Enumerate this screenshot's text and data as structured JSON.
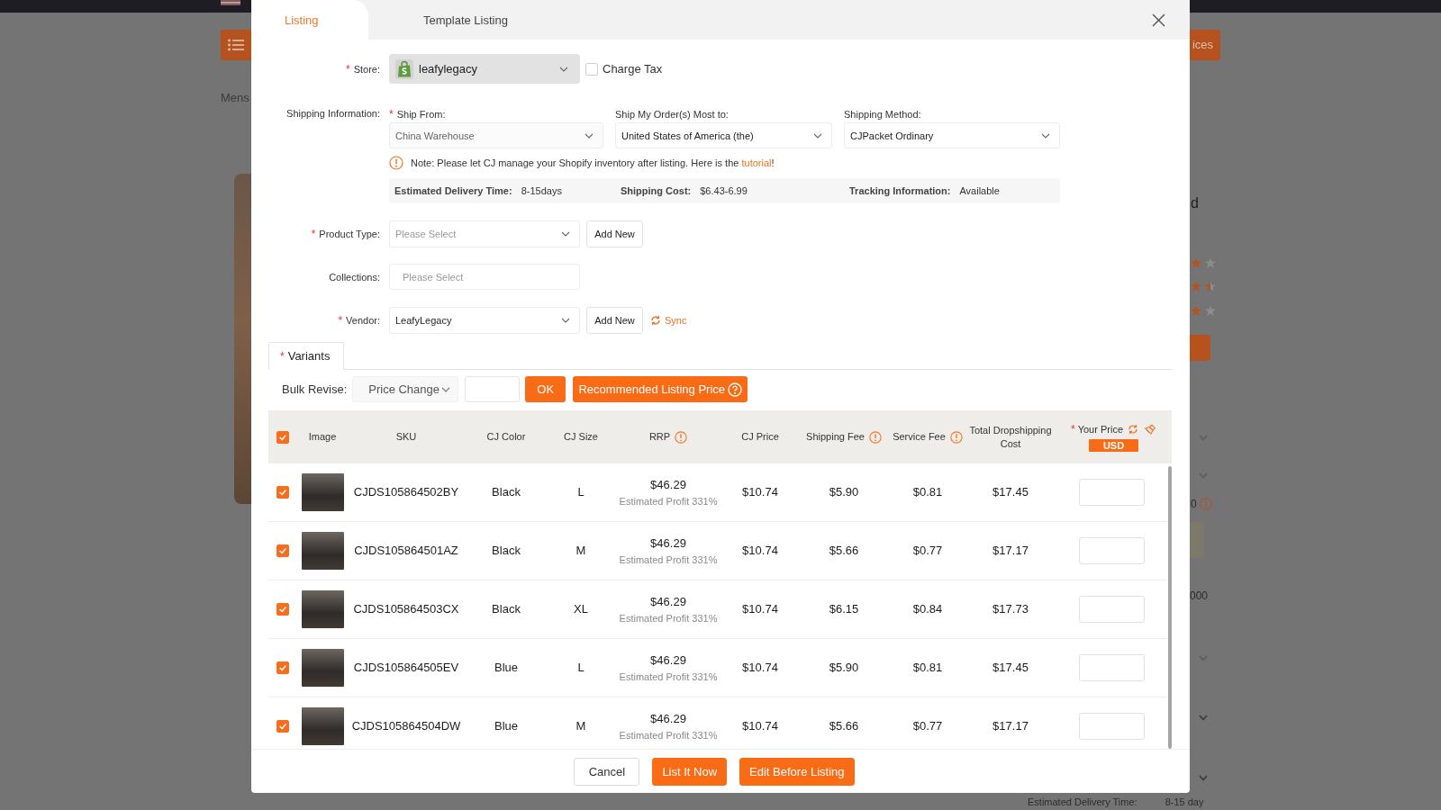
{
  "background_page": {
    "breadcrumb": "Mens",
    "header_button": "ices",
    "title_fragment": "d",
    "rating_rows": [
      {
        "icons": [
          {
            "kind": "full"
          },
          {
            "kind": "empty"
          }
        ]
      },
      {
        "icons": [
          {
            "kind": "full"
          },
          {
            "kind": "half"
          }
        ]
      },
      {
        "icons": [
          {
            "kind": "full"
          },
          {
            "kind": "empty"
          }
        ]
      }
    ],
    "count_fragment": "0",
    "amount_fragment": "000",
    "delivery_label": "Estimated Delivery Time:",
    "delivery_value": "8-15 day"
  },
  "dialog": {
    "tabs": [
      {
        "label": "Listing",
        "selected": true
      },
      {
        "label": "Template Listing",
        "selected": false
      }
    ]
  },
  "required_mark": "*",
  "form": {
    "store": {
      "label": "Store:",
      "required": true,
      "value": "leafylegacy",
      "disabled": true
    },
    "charge_tax": {
      "label": "Charge Tax",
      "checked": false
    },
    "shipping": {
      "label": "Shipping Information:",
      "fields": [
        {
          "label": "Ship From:",
          "required": true,
          "value": "China Warehouse",
          "disabled": true
        },
        {
          "label": "Ship My Order(s) Most to:",
          "required": false,
          "value": "United States of America (the)",
          "disabled": false
        },
        {
          "label": "Shipping Method:",
          "required": false,
          "value": "CJPacket Ordinary",
          "disabled": false
        }
      ],
      "note": {
        "text": "Note: Please let CJ manage your Shopify inventory after listing. Here is the ",
        "link": "tutorial",
        "end": "!"
      },
      "summary": [
        {
          "label": "Estimated Delivery Time:",
          "value": "8-15days"
        },
        {
          "label": "Shipping Cost:",
          "value": "$6.43-6.99"
        },
        {
          "label": "Tracking Information:",
          "value": "Available"
        }
      ]
    },
    "product_type": {
      "label": "Product Type:",
      "required": true,
      "placeholder": "Please Select",
      "button": "Add New"
    },
    "collections": {
      "label": "Collections:",
      "required": false,
      "placeholder": "Please Select"
    },
    "vendor": {
      "label": "Vendor:",
      "required": true,
      "value": "LeafyLegacy",
      "button": "Add New",
      "sync": "Sync"
    }
  },
  "variants": {
    "tab": {
      "label": "Variants",
      "required": true
    },
    "bulk_revise": {
      "label": "Bulk Revise:",
      "mode": "Price Change",
      "ok": "OK",
      "recommend": "Recommended Listing Price"
    },
    "table": {
      "select_all": {
        "checked": true
      },
      "columns": [
        {
          "label": "Image",
          "required": false,
          "info": false,
          "actions": false
        },
        {
          "label": "SKU",
          "required": false,
          "info": false,
          "actions": false
        },
        {
          "label": "CJ Color",
          "required": false,
          "info": false,
          "actions": false
        },
        {
          "label": "CJ Size",
          "required": false,
          "info": false,
          "actions": false
        },
        {
          "label": "RRP",
          "required": false,
          "info": true,
          "actions": false
        },
        {
          "label": "CJ Price",
          "required": false,
          "info": false,
          "actions": false
        },
        {
          "label": "Shipping Fee",
          "required": false,
          "info": true,
          "actions": false
        },
        {
          "label": "Service Fee",
          "required": false,
          "info": true,
          "actions": false
        },
        {
          "label": "Total Dropshipping Cost",
          "required": false,
          "info": false,
          "actions": false
        },
        {
          "label": "Your Price",
          "required": true,
          "info": false,
          "actions": true,
          "currency": "USD"
        }
      ],
      "rows": [
        {
          "checked": true,
          "sku": "CJDS105864502BY",
          "cj_color": "Black",
          "size": "L",
          "rrp": "$46.29",
          "profit": "Estimated Profit 331%",
          "cj_price": "$10.74",
          "shipping_fee": "$5.90",
          "service_fee": "$0.81",
          "total": "$17.45"
        },
        {
          "checked": true,
          "sku": "CJDS105864501AZ",
          "cj_color": "Black",
          "size": "M",
          "rrp": "$46.29",
          "profit": "Estimated Profit 331%",
          "cj_price": "$10.74",
          "shipping_fee": "$5.66",
          "service_fee": "$0.77",
          "total": "$17.17"
        },
        {
          "checked": true,
          "sku": "CJDS105864503CX",
          "cj_color": "Black",
          "size": "XL",
          "rrp": "$46.29",
          "profit": "Estimated Profit 331%",
          "cj_price": "$10.74",
          "shipping_fee": "$6.15",
          "service_fee": "$0.84",
          "total": "$17.73"
        },
        {
          "checked": true,
          "sku": "CJDS105864505EV",
          "cj_color": "Blue",
          "size": "L",
          "rrp": "$46.29",
          "profit": "Estimated Profit 331%",
          "cj_price": "$10.74",
          "shipping_fee": "$5.90",
          "service_fee": "$0.81",
          "total": "$17.45"
        },
        {
          "checked": true,
          "sku": "CJDS105864504DW",
          "cj_color": "Blue",
          "size": "M",
          "rrp": "$46.29",
          "profit": "Estimated Profit 331%",
          "cj_price": "$10.74",
          "shipping_fee": "$5.66",
          "service_fee": "$0.77",
          "total": "$17.17"
        }
      ]
    }
  },
  "footer": {
    "buttons": [
      {
        "label": "Cancel",
        "kind": "secondary"
      },
      {
        "label": "List It Now",
        "kind": "primary"
      },
      {
        "label": "Edit Before Listing",
        "kind": "primary"
      }
    ]
  }
}
